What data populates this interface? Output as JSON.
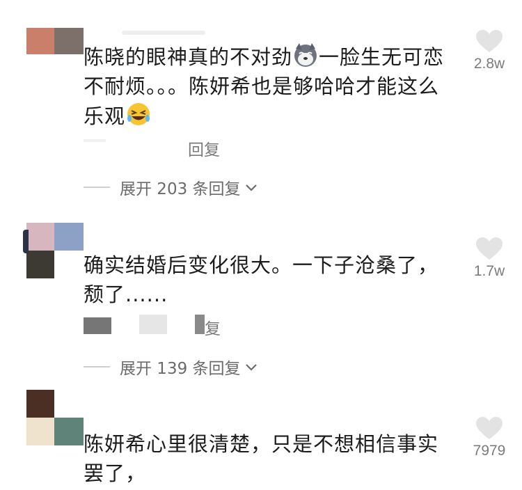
{
  "comments": [
    {
      "text": "陈晓的眼神真的不对劲",
      "text_after_emoji": "一脸生无可恋不耐烦。。。陈妍希也是够哈哈才能这么乐观",
      "emoji_1": "husky-dog-face",
      "emoji_2": "rolling-laughing-face",
      "likes": "2.8w",
      "reply_label": "回复",
      "expand_label": "展开 203 条回复",
      "avatar_colors": [
        "#c97f69",
        "#7d6f69"
      ]
    },
    {
      "text": "确实结婚后变化很大。一下子沧桑了，颓了......",
      "likes": "1.7w",
      "reply_label": "复",
      "expand_label": "展开 139 条回复",
      "avatar_colors": [
        "#d8b6bf",
        "#8da1c6",
        "#3d3a33"
      ]
    },
    {
      "text": "陈妍希心里很清楚，只是不想相信事实罢了，",
      "likes": "7979",
      "avatar_colors": [
        "#4b2e24",
        "#efe3cd",
        "#5f8279"
      ]
    }
  ],
  "colors": {
    "text": "#1c1c1c",
    "muted": "#7a7a7a",
    "heart": "#e3e3e3"
  }
}
